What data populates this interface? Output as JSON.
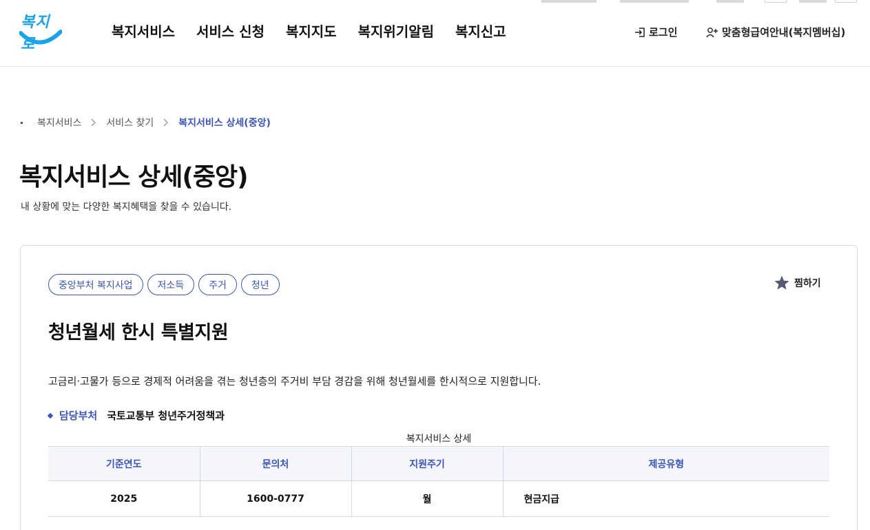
{
  "header": {
    "logo_text": "복지로",
    "nav": [
      "복지서비스",
      "서비스 신청",
      "복지지도",
      "복지위기알림",
      "복지신고"
    ],
    "login": "로그인",
    "member_guide": "맞춤형급여안내(복지멤버십)"
  },
  "breadcrumb": [
    "복지서비스",
    "서비스 찾기",
    "복지서비스 상세(중앙)"
  ],
  "page": {
    "title": "복지서비스 상세(중앙)",
    "description": "내 상황에 맞는 다양한 복지혜택을 찾을 수 있습니다."
  },
  "service": {
    "tags": [
      "중앙부처 복지사업",
      "저소득",
      "주거",
      "청년"
    ],
    "favorite_label": "찜하기",
    "title": "청년월세 한시 특별지원",
    "description": "고금리·고물가 등으로 경제적 어려움을 겪는 청년층의 주거비 부담 경감을 위해 청년월세를 한시적으로 지원합니다.",
    "dept_label": "담당부처",
    "dept_value": "국토교통부 청년주거정책과",
    "table": {
      "caption": "복지서비스 상세",
      "headers": [
        "기준연도",
        "문의처",
        "지원주기",
        "제공유형"
      ],
      "row": [
        "2025",
        "1600-0777",
        "월",
        "현금지급"
      ]
    }
  },
  "colors": {
    "accent": "#3c55b4",
    "logo": "#1aa3e8",
    "table_header_bg": "#f4f6fb"
  },
  "icons": {
    "login": "login-icon",
    "member": "person-add-icon",
    "favorite": "star-icon",
    "breadcrumb_sep": "chevron-right-icon"
  }
}
